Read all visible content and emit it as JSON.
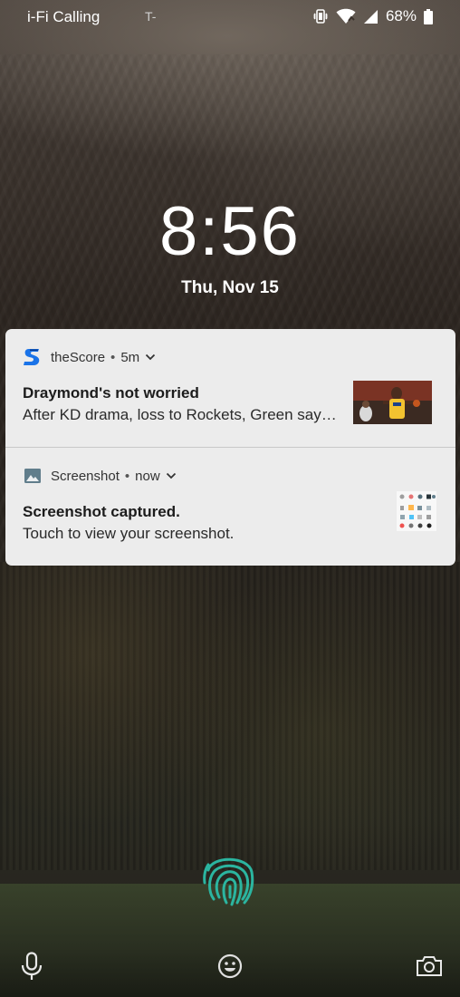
{
  "status_bar": {
    "carrier": "i-Fi Calling",
    "carrier_icon_text": "T-",
    "icons": [
      "vibrate-icon",
      "wifi-icon",
      "cell-signal-icon",
      "battery-icon"
    ],
    "battery_percent": "68%"
  },
  "lockscreen": {
    "time": "8:56",
    "date": "Thu, Nov 15"
  },
  "notifications": [
    {
      "app_name": "theScore",
      "separator": "•",
      "time_ago": "5m",
      "title": "Draymond's not worried",
      "body": "After KD drama, loss to Rockets, Green say…",
      "icon": "thescore-app-icon",
      "accent_color": "#1a73e8"
    },
    {
      "app_name": "Screenshot",
      "separator": "•",
      "time_ago": "now",
      "title": "Screenshot captured.",
      "body": "Touch to view your screenshot.",
      "icon": "image-icon",
      "accent_color": "#607d8b"
    }
  ],
  "bottom_bar": {
    "left_icon": "microphone-icon",
    "center_icon": "emoji-icon",
    "right_icon": "camera-icon",
    "fingerprint_color": "#2bb5a0"
  }
}
